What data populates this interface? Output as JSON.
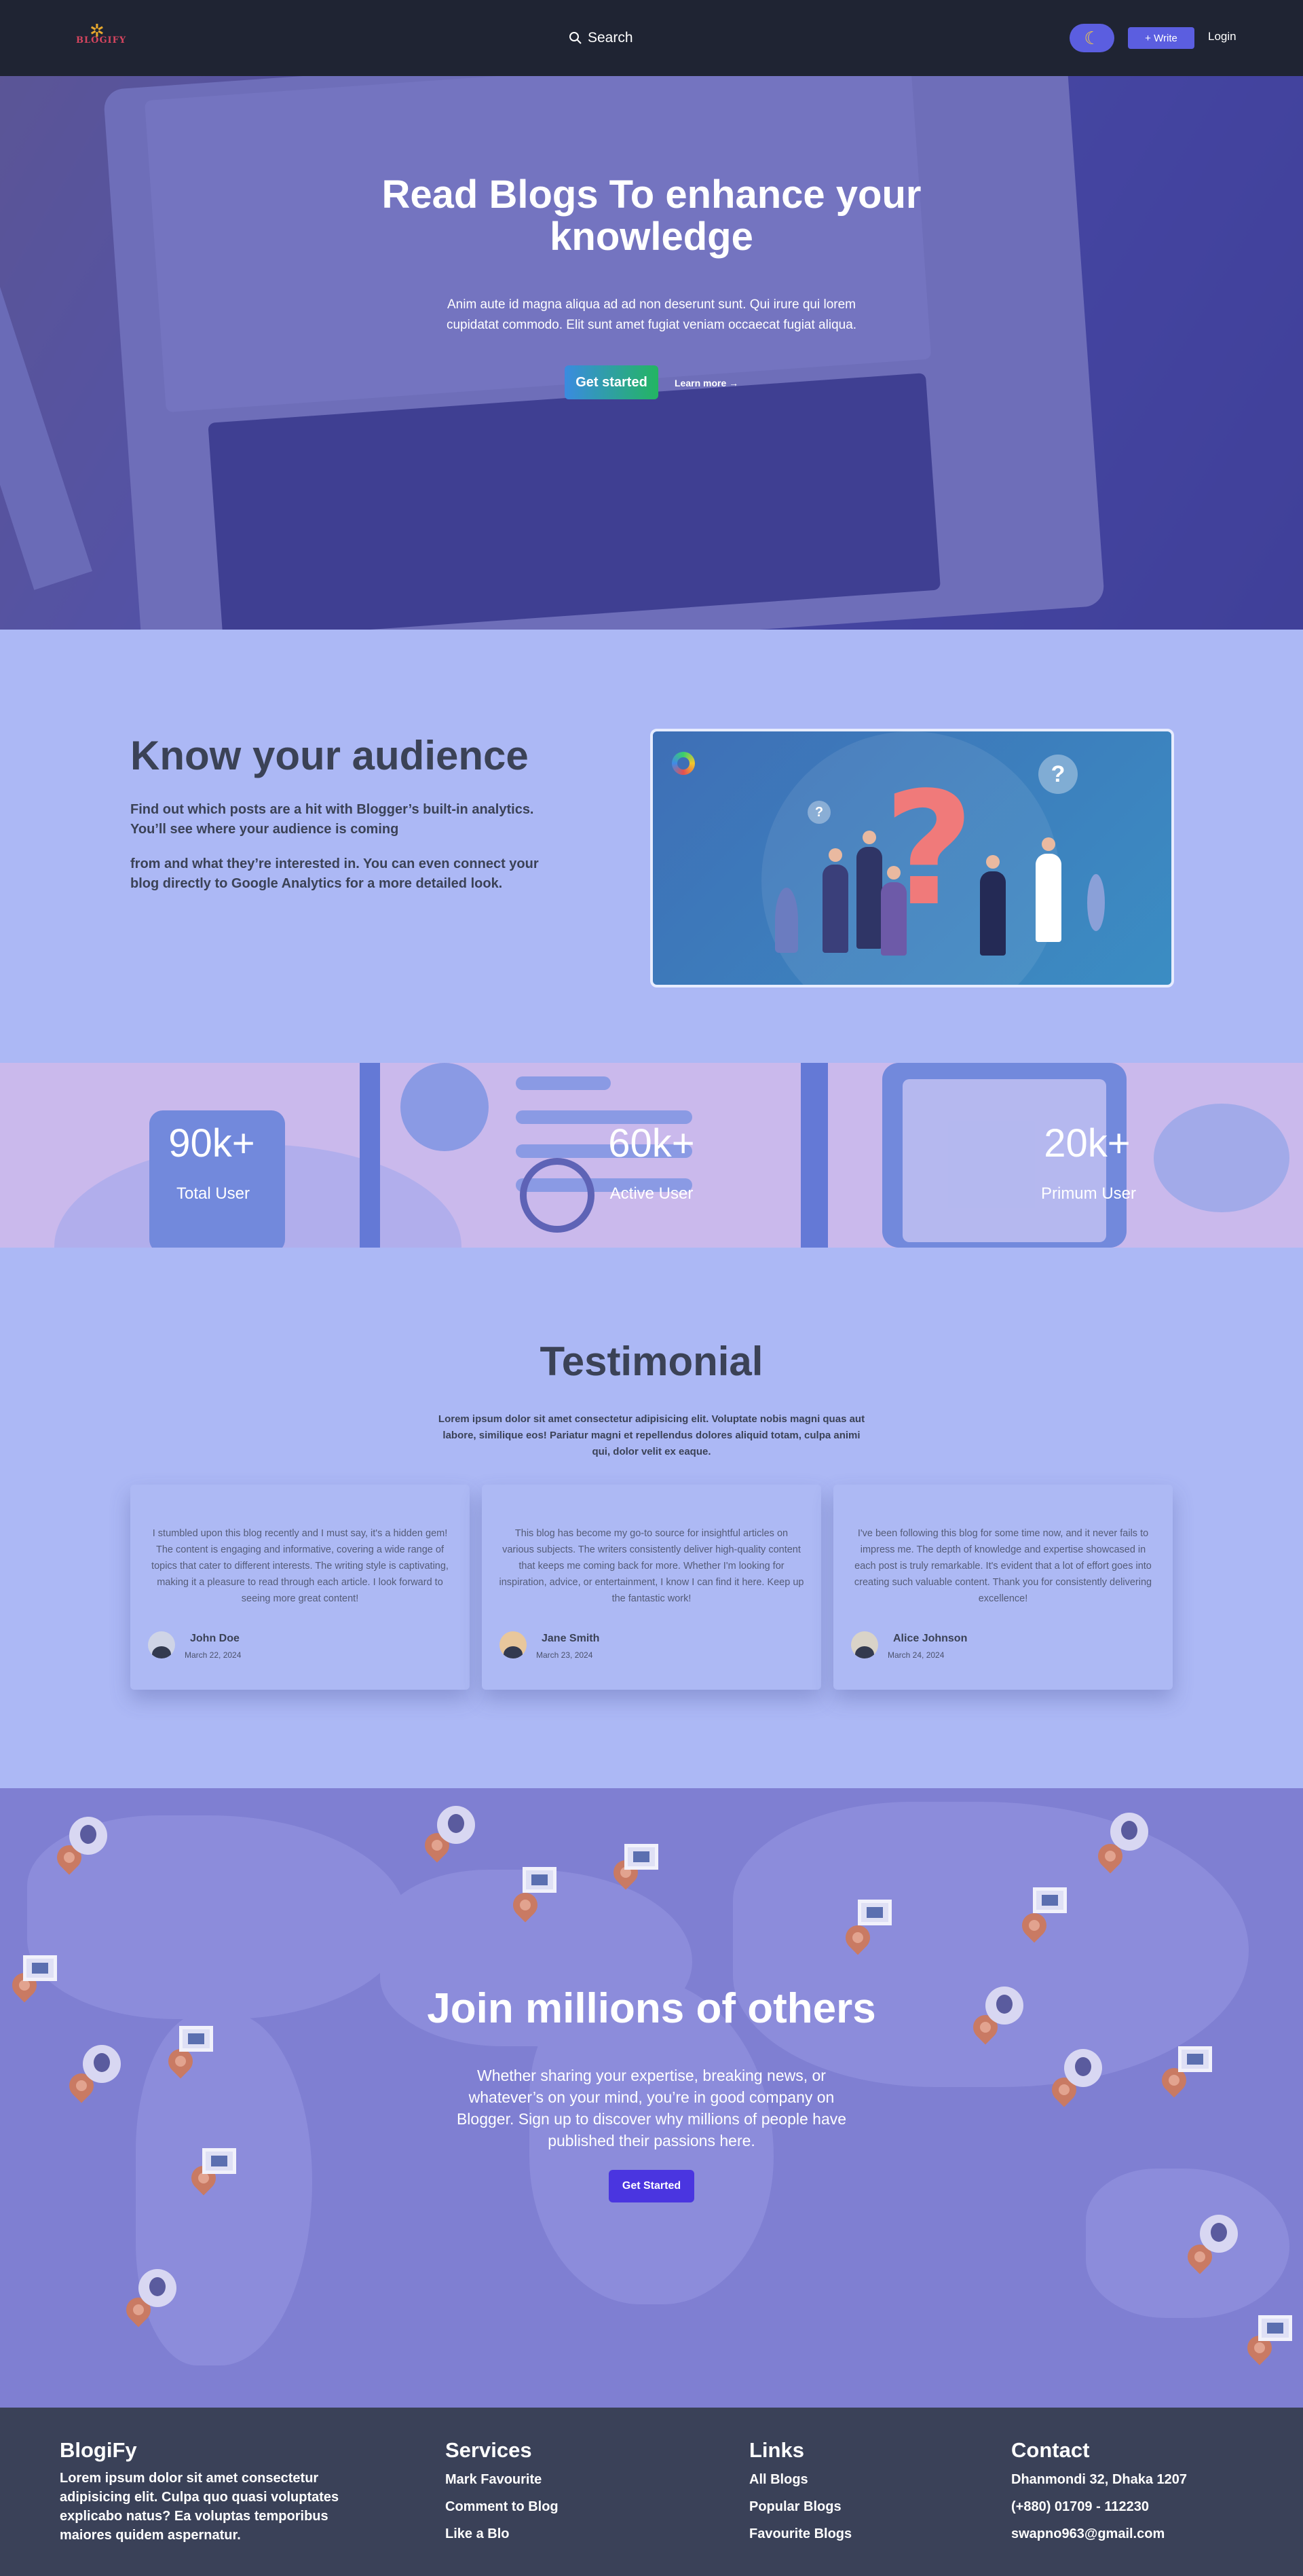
{
  "nav": {
    "logo_text": "BLOGIFY",
    "search_label": "Search",
    "theme_icon": "moon-icon",
    "write_label": "+ Write",
    "login_label": "Login"
  },
  "hero": {
    "title": "Read Blogs To enhance your knowledge",
    "subtitle": "Anim aute id magna aliqua ad ad non deserunt sunt. Qui irure qui lorem cupidatat commodo. Elit sunt amet fugiat veniam occaecat fugiat aliqua.",
    "cta_label": "Get started",
    "more_label": "Learn more →"
  },
  "audience": {
    "title": "Know your audience",
    "p1": "Find out which posts are a hit with Blogger’s built-in analytics. You’ll see where your audience is coming",
    "p2": "from and what they’re interested in. You can even connect your blog directly to Google Analytics for a more detailed look."
  },
  "stats": [
    {
      "value": "90k+",
      "label": "Total User"
    },
    {
      "value": "60k+",
      "label": "Active User"
    },
    {
      "value": "20k+",
      "label": "Primum User"
    }
  ],
  "testimonial": {
    "title": "Testimonial",
    "subtitle": "Lorem ipsum dolor sit amet consectetur adipisicing elit. Voluptate nobis magni quas aut labore, similique eos! Pariatur magni et repellendus dolores aliquid totam, culpa animi qui, dolor velit ex eaque.",
    "cards": [
      {
        "text": "I stumbled upon this blog recently and I must say, it's a hidden gem! The content is engaging and informative, covering a wide range of topics that cater to different interests. The writing style is captivating, making it a pleasure to read through each article. I look forward to seeing more great content!",
        "name": "John Doe",
        "date": "March 22, 2024"
      },
      {
        "text": "This blog has become my go-to source for insightful articles on various subjects. The writers consistently deliver high-quality content that keeps me coming back for more. Whether I'm looking for inspiration, advice, or entertainment, I know I can find it here. Keep up the fantastic work!",
        "name": "Jane Smith",
        "date": "March 23, 2024"
      },
      {
        "text": "I've been following this blog for some time now, and it never fails to impress me. The depth of knowledge and expertise showcased in each post is truly remarkable. It's evident that a lot of effort goes into creating such valuable content. Thank you for consistently delivering excellence!",
        "name": "Alice Johnson",
        "date": "March 24, 2024"
      }
    ]
  },
  "join": {
    "title": "Join millions of others",
    "subtitle": "Whether sharing your expertise, breaking news, or whatever’s on your mind, you’re in good company on Blogger. Sign up to discover why millions of people have published their passions here.",
    "cta_label": "Get Started"
  },
  "footer": {
    "brand": {
      "title": "BlogiFy",
      "text": "Lorem ipsum dolor sit amet consectetur adipisicing elit. Culpa quo quasi voluptates explicabo natus? Ea voluptas temporibus maiores quidem aspernatur."
    },
    "services": {
      "title": "Services",
      "items": [
        "Mark Favourite",
        "Comment to Blog",
        "Like a Blo"
      ]
    },
    "links": {
      "title": "Links",
      "items": [
        "All Blogs",
        "Popular Blogs",
        "Favourite Blogs"
      ]
    },
    "contact": {
      "title": "Contact",
      "items": [
        "Dhanmondi 32, Dhaka 1207",
        "(+880) 01709 - 112230",
        "swapno963@gmail.com"
      ]
    }
  },
  "colors": {
    "nav_bg": "#1f2433",
    "page_bg": "#acb8f5",
    "accent": "#5b5ee0",
    "join_bg": "#7f7fd2",
    "footer_bg": "#3a4158"
  }
}
